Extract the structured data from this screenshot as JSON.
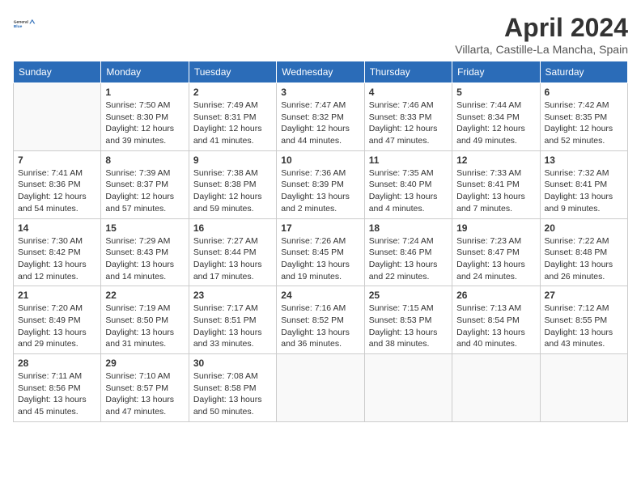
{
  "header": {
    "logo_line1": "General",
    "logo_line2": "Blue",
    "title": "April 2024",
    "location": "Villarta, Castille-La Mancha, Spain"
  },
  "days_of_week": [
    "Sunday",
    "Monday",
    "Tuesday",
    "Wednesday",
    "Thursday",
    "Friday",
    "Saturday"
  ],
  "weeks": [
    [
      {
        "day": "",
        "info": ""
      },
      {
        "day": "1",
        "info": "Sunrise: 7:50 AM\nSunset: 8:30 PM\nDaylight: 12 hours and 39 minutes."
      },
      {
        "day": "2",
        "info": "Sunrise: 7:49 AM\nSunset: 8:31 PM\nDaylight: 12 hours and 41 minutes."
      },
      {
        "day": "3",
        "info": "Sunrise: 7:47 AM\nSunset: 8:32 PM\nDaylight: 12 hours and 44 minutes."
      },
      {
        "day": "4",
        "info": "Sunrise: 7:46 AM\nSunset: 8:33 PM\nDaylight: 12 hours and 47 minutes."
      },
      {
        "day": "5",
        "info": "Sunrise: 7:44 AM\nSunset: 8:34 PM\nDaylight: 12 hours and 49 minutes."
      },
      {
        "day": "6",
        "info": "Sunrise: 7:42 AM\nSunset: 8:35 PM\nDaylight: 12 hours and 52 minutes."
      }
    ],
    [
      {
        "day": "7",
        "info": "Sunrise: 7:41 AM\nSunset: 8:36 PM\nDaylight: 12 hours and 54 minutes."
      },
      {
        "day": "8",
        "info": "Sunrise: 7:39 AM\nSunset: 8:37 PM\nDaylight: 12 hours and 57 minutes."
      },
      {
        "day": "9",
        "info": "Sunrise: 7:38 AM\nSunset: 8:38 PM\nDaylight: 12 hours and 59 minutes."
      },
      {
        "day": "10",
        "info": "Sunrise: 7:36 AM\nSunset: 8:39 PM\nDaylight: 13 hours and 2 minutes."
      },
      {
        "day": "11",
        "info": "Sunrise: 7:35 AM\nSunset: 8:40 PM\nDaylight: 13 hours and 4 minutes."
      },
      {
        "day": "12",
        "info": "Sunrise: 7:33 AM\nSunset: 8:41 PM\nDaylight: 13 hours and 7 minutes."
      },
      {
        "day": "13",
        "info": "Sunrise: 7:32 AM\nSunset: 8:41 PM\nDaylight: 13 hours and 9 minutes."
      }
    ],
    [
      {
        "day": "14",
        "info": "Sunrise: 7:30 AM\nSunset: 8:42 PM\nDaylight: 13 hours and 12 minutes."
      },
      {
        "day": "15",
        "info": "Sunrise: 7:29 AM\nSunset: 8:43 PM\nDaylight: 13 hours and 14 minutes."
      },
      {
        "day": "16",
        "info": "Sunrise: 7:27 AM\nSunset: 8:44 PM\nDaylight: 13 hours and 17 minutes."
      },
      {
        "day": "17",
        "info": "Sunrise: 7:26 AM\nSunset: 8:45 PM\nDaylight: 13 hours and 19 minutes."
      },
      {
        "day": "18",
        "info": "Sunrise: 7:24 AM\nSunset: 8:46 PM\nDaylight: 13 hours and 22 minutes."
      },
      {
        "day": "19",
        "info": "Sunrise: 7:23 AM\nSunset: 8:47 PM\nDaylight: 13 hours and 24 minutes."
      },
      {
        "day": "20",
        "info": "Sunrise: 7:22 AM\nSunset: 8:48 PM\nDaylight: 13 hours and 26 minutes."
      }
    ],
    [
      {
        "day": "21",
        "info": "Sunrise: 7:20 AM\nSunset: 8:49 PM\nDaylight: 13 hours and 29 minutes."
      },
      {
        "day": "22",
        "info": "Sunrise: 7:19 AM\nSunset: 8:50 PM\nDaylight: 13 hours and 31 minutes."
      },
      {
        "day": "23",
        "info": "Sunrise: 7:17 AM\nSunset: 8:51 PM\nDaylight: 13 hours and 33 minutes."
      },
      {
        "day": "24",
        "info": "Sunrise: 7:16 AM\nSunset: 8:52 PM\nDaylight: 13 hours and 36 minutes."
      },
      {
        "day": "25",
        "info": "Sunrise: 7:15 AM\nSunset: 8:53 PM\nDaylight: 13 hours and 38 minutes."
      },
      {
        "day": "26",
        "info": "Sunrise: 7:13 AM\nSunset: 8:54 PM\nDaylight: 13 hours and 40 minutes."
      },
      {
        "day": "27",
        "info": "Sunrise: 7:12 AM\nSunset: 8:55 PM\nDaylight: 13 hours and 43 minutes."
      }
    ],
    [
      {
        "day": "28",
        "info": "Sunrise: 7:11 AM\nSunset: 8:56 PM\nDaylight: 13 hours and 45 minutes."
      },
      {
        "day": "29",
        "info": "Sunrise: 7:10 AM\nSunset: 8:57 PM\nDaylight: 13 hours and 47 minutes."
      },
      {
        "day": "30",
        "info": "Sunrise: 7:08 AM\nSunset: 8:58 PM\nDaylight: 13 hours and 50 minutes."
      },
      {
        "day": "",
        "info": ""
      },
      {
        "day": "",
        "info": ""
      },
      {
        "day": "",
        "info": ""
      },
      {
        "day": "",
        "info": ""
      }
    ]
  ]
}
